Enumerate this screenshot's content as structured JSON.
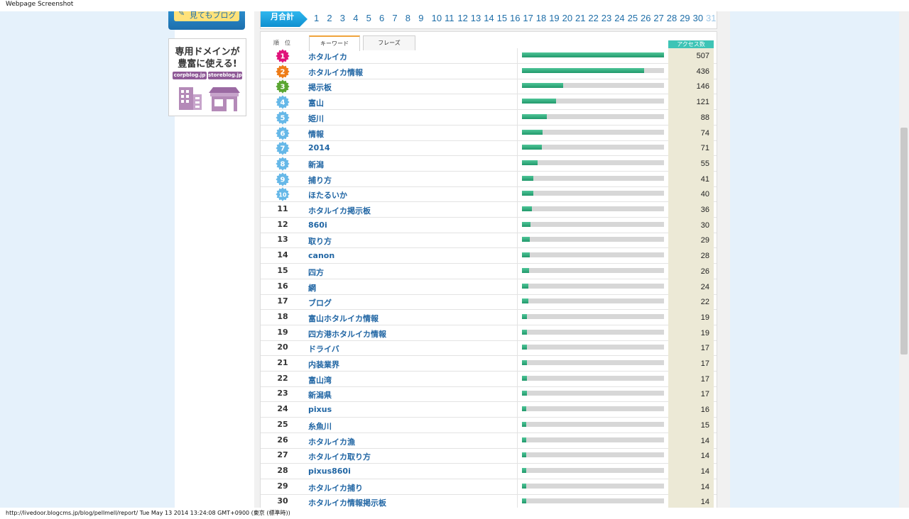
{
  "window": {
    "title": "Webpage Screenshot"
  },
  "status": {
    "text": "http://livedoor.blogcms.jp/blog/pellmell/report/ Tue May 13 2014 13:24:08 GMT+0900 (東京 (標準時))"
  },
  "sidebar": {
    "top_button_label": "見てもブログ",
    "ad": {
      "line1": "専用ドメインが",
      "line2": "豊富に使える!",
      "tag1": "corpblog.jp",
      "tag2": "storeblog.jp"
    }
  },
  "monthbar": {
    "label": "月合計",
    "days": [
      "1",
      "2",
      "3",
      "4",
      "5",
      "6",
      "7",
      "8",
      "9",
      "10",
      "11",
      "12",
      "13",
      "14",
      "15",
      "16",
      "17",
      "18",
      "19",
      "20",
      "21",
      "22",
      "23",
      "24",
      "25",
      "26",
      "27",
      "28",
      "29",
      "30",
      "31"
    ]
  },
  "table": {
    "header_rank": "順位",
    "tab_keyword": "キーワード",
    "tab_phrase": "フレーズ",
    "header_count": "アクセス数",
    "max": 507,
    "rows": [
      {
        "rank": "1",
        "keyword": "ホタルイカ",
        "count": "507",
        "value": 507
      },
      {
        "rank": "2",
        "keyword": "ホタルイカ情報",
        "count": "436",
        "value": 436
      },
      {
        "rank": "3",
        "keyword": "掲示板",
        "count": "146",
        "value": 146
      },
      {
        "rank": "4",
        "keyword": "富山",
        "count": "121",
        "value": 121
      },
      {
        "rank": "5",
        "keyword": "姫川",
        "count": "88",
        "value": 88
      },
      {
        "rank": "6",
        "keyword": "情報",
        "count": "74",
        "value": 74
      },
      {
        "rank": "7",
        "keyword": "2014",
        "count": "71",
        "value": 71
      },
      {
        "rank": "8",
        "keyword": "新潟",
        "count": "55",
        "value": 55
      },
      {
        "rank": "9",
        "keyword": "捕り方",
        "count": "41",
        "value": 41
      },
      {
        "rank": "10",
        "keyword": "ほたるいか",
        "count": "40",
        "value": 40
      },
      {
        "rank": "11",
        "keyword": "ホタルイカ掲示板",
        "count": "36",
        "value": 36
      },
      {
        "rank": "12",
        "keyword": "860i",
        "count": "30",
        "value": 30
      },
      {
        "rank": "13",
        "keyword": "取り方",
        "count": "29",
        "value": 29
      },
      {
        "rank": "14",
        "keyword": "canon",
        "count": "28",
        "value": 28
      },
      {
        "rank": "15",
        "keyword": "四方",
        "count": "26",
        "value": 26
      },
      {
        "rank": "16",
        "keyword": "網",
        "count": "24",
        "value": 24
      },
      {
        "rank": "17",
        "keyword": "ブログ",
        "count": "22",
        "value": 22
      },
      {
        "rank": "18",
        "keyword": "富山ホタルイカ情報",
        "count": "19",
        "value": 19
      },
      {
        "rank": "19",
        "keyword": "四方港ホタルイカ情報",
        "count": "19",
        "value": 19
      },
      {
        "rank": "20",
        "keyword": "ドライバ",
        "count": "17",
        "value": 17
      },
      {
        "rank": "21",
        "keyword": "内装業界",
        "count": "17",
        "value": 17
      },
      {
        "rank": "22",
        "keyword": "富山湾",
        "count": "17",
        "value": 17
      },
      {
        "rank": "23",
        "keyword": "新潟県",
        "count": "17",
        "value": 17
      },
      {
        "rank": "24",
        "keyword": "pixus",
        "count": "16",
        "value": 16
      },
      {
        "rank": "25",
        "keyword": "糸魚川",
        "count": "15",
        "value": 15
      },
      {
        "rank": "26",
        "keyword": "ホタルイカ漁",
        "count": "14",
        "value": 14
      },
      {
        "rank": "27",
        "keyword": "ホタルイカ取り方",
        "count": "14",
        "value": 14
      },
      {
        "rank": "28",
        "keyword": "pixus860i",
        "count": "14",
        "value": 14
      },
      {
        "rank": "29",
        "keyword": "ホタルイカ捕り",
        "count": "14",
        "value": 14
      },
      {
        "rank": "30",
        "keyword": "ホタルイカ情報掲示板",
        "count": "14",
        "value": 14
      }
    ]
  },
  "colors": {
    "badge_1": "#e0127a",
    "badge_2": "#ee7c17",
    "badge_3": "#5aa632",
    "badge_other": "#66b8e8",
    "bar": "#21996b",
    "count_bg": "#ece9d6",
    "keyword": "#2166a4"
  }
}
